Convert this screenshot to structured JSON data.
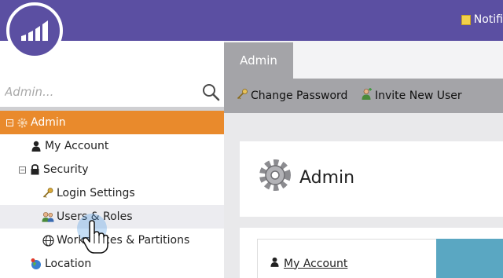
{
  "header": {
    "notifications_label": "Notifi",
    "logo_icon": "marketo-bars-icon",
    "brand_color": "#5b4fa2"
  },
  "search": {
    "placeholder": "Admin...",
    "icon": "search-icon"
  },
  "tree": {
    "items": [
      {
        "label": "Admin",
        "icon": "gear-icon",
        "toggle": "−",
        "state": "selected"
      },
      {
        "label": "My Account",
        "icon": "person-icon"
      },
      {
        "label": "Security",
        "icon": "lock-icon",
        "toggle": "−"
      },
      {
        "label": "Login Settings",
        "icon": "keys-icon"
      },
      {
        "label": "Users & Roles",
        "icon": "users-icon",
        "state": "hover"
      },
      {
        "label": "Workspaces & Partitions",
        "icon": "globe-icon"
      },
      {
        "label": "Location",
        "icon": "location-globe-icon"
      }
    ],
    "selected_color": "#e98a2c"
  },
  "main": {
    "tab_label": "Admin",
    "toolbar": {
      "change_password": "Change Password",
      "invite_user": "Invite New User"
    },
    "hero_title": "Admin",
    "card_link": "My Account"
  }
}
